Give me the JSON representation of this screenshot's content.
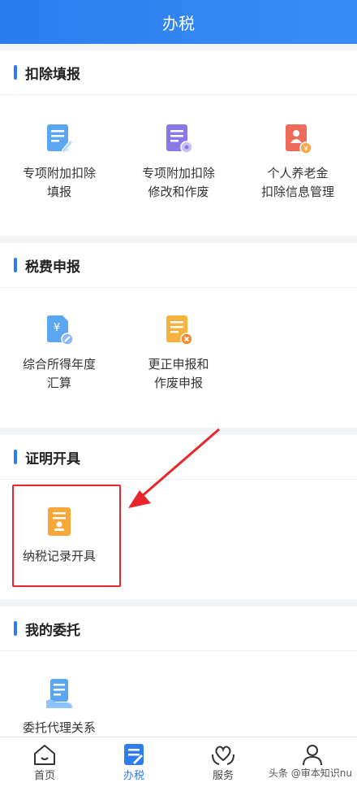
{
  "header": {
    "title": "办税"
  },
  "sections": [
    {
      "title": "扣除填报",
      "items": [
        {
          "line1": "专项附加扣除",
          "line2": "填报",
          "icon": "document-edit-icon"
        },
        {
          "line1": "专项附加扣除",
          "line2": "修改和作废",
          "icon": "document-gear-icon"
        },
        {
          "line1": "个人养老金",
          "line2": "扣除信息管理",
          "icon": "pension-document-icon"
        }
      ]
    },
    {
      "title": "税费申报",
      "items": [
        {
          "line1": "综合所得年度",
          "line2": "汇算",
          "icon": "yuan-document-icon"
        },
        {
          "line1": "更正申报和",
          "line2": "作废申报",
          "icon": "document-cancel-icon"
        }
      ]
    },
    {
      "title": "证明开具",
      "items": [
        {
          "line1": "纳税记录开具",
          "line2": "",
          "icon": "certificate-stamp-icon"
        }
      ]
    },
    {
      "title": "我的委托",
      "items": [
        {
          "line1": "委托代理关系",
          "line2": "",
          "icon": "entrust-document-icon"
        }
      ]
    }
  ],
  "tabbar": {
    "tabs": [
      {
        "label": "首页",
        "icon": "home-icon"
      },
      {
        "label": "办税",
        "icon": "tax-document-icon",
        "active": true
      },
      {
        "label": "服务",
        "icon": "heart-hands-icon"
      },
      {
        "label": "我的",
        "icon": "user-icon"
      }
    ]
  },
  "watermark": "头条 @审本知识nu",
  "colors": {
    "accent": "#2f7cf0",
    "highlight": "#e8262b"
  }
}
